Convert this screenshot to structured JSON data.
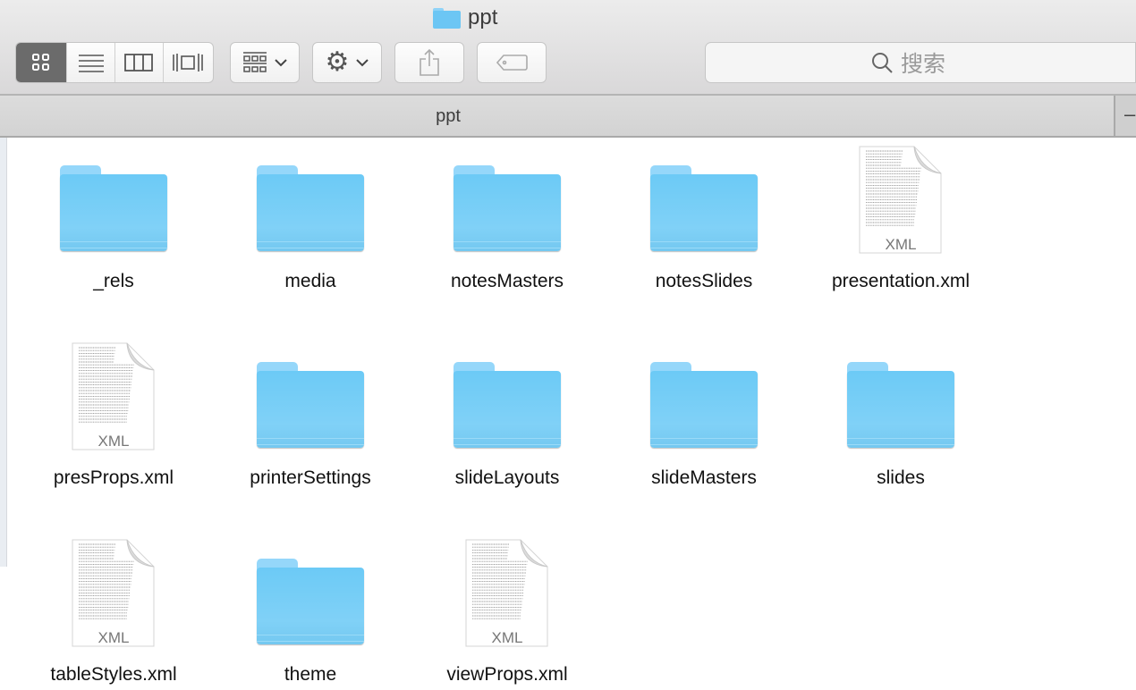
{
  "window": {
    "title": "ppt"
  },
  "toolbar": {
    "view_modes": [
      {
        "name": "icon-view",
        "active": true
      },
      {
        "name": "list-view",
        "active": false
      },
      {
        "name": "column-view",
        "active": false
      },
      {
        "name": "cover-flow-view",
        "active": false
      }
    ],
    "search_placeholder": "搜索"
  },
  "pathbar": {
    "label": "ppt",
    "add_label": "–"
  },
  "items": [
    {
      "name": "_rels",
      "type": "folder"
    },
    {
      "name": "media",
      "type": "folder"
    },
    {
      "name": "notesMasters",
      "type": "folder"
    },
    {
      "name": "notesSlides",
      "type": "folder"
    },
    {
      "name": "presentation.xml",
      "type": "xml",
      "badge": "XML"
    },
    {
      "name": "presProps.xml",
      "type": "xml",
      "badge": "XML"
    },
    {
      "name": "printerSettings",
      "type": "folder"
    },
    {
      "name": "slideLayouts",
      "type": "folder"
    },
    {
      "name": "slideMasters",
      "type": "folder"
    },
    {
      "name": "slides",
      "type": "folder"
    },
    {
      "name": "tableStyles.xml",
      "type": "xml",
      "badge": "XML"
    },
    {
      "name": "theme",
      "type": "folder"
    },
    {
      "name": "viewProps.xml",
      "type": "xml",
      "badge": "XML"
    }
  ]
}
